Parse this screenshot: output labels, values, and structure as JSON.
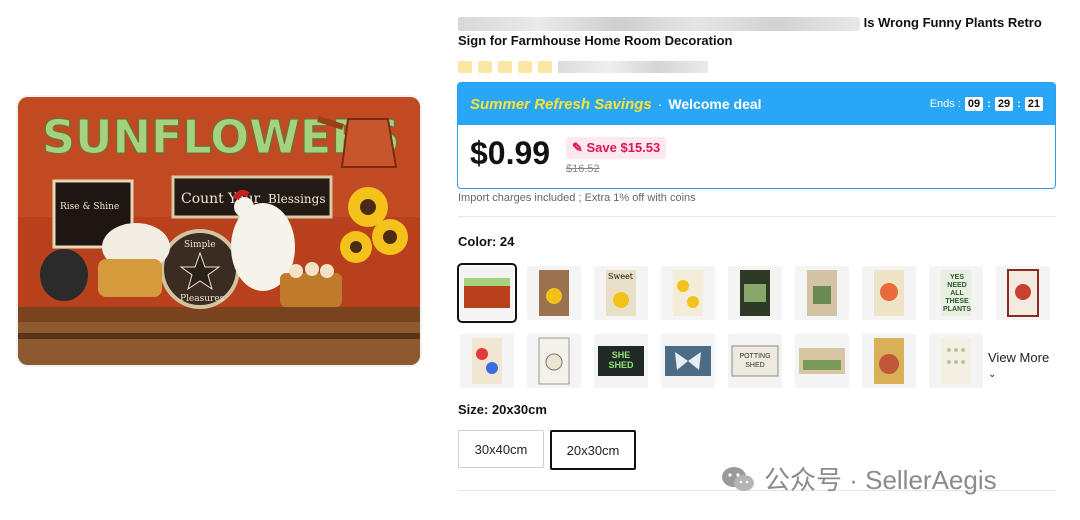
{
  "product": {
    "title_tail": "Is Wrong Funny Plants Retro",
    "title_line2": "Sign for Farmhouse Home Room Decoration",
    "image_texts": {
      "headline": "SUNFLOWERS",
      "sign_left_a": "Rise & Shine",
      "sign_middle_a": "Count",
      "sign_middle_b": "Your",
      "sign_middle_c": "Blessings",
      "plaque_top": "Simple",
      "plaque_bottom": "Pleasures"
    }
  },
  "deal": {
    "name": "Summer Refresh Savings",
    "separator": "·",
    "tag": "Welcome deal",
    "ends_label": "Ends :",
    "timer": [
      "09",
      "29",
      "21"
    ],
    "price": "$0.99",
    "save": "Save $15.53",
    "old_price": "$16.52"
  },
  "import_note": "Import charges included ; Extra 1% off with coins",
  "color": {
    "label": "Color: 24",
    "view_more": "View More",
    "thumb_labels": {
      "t2": "Sweet",
      "t7": "YES NEED ALL THESE PLANTS",
      "t12": "SHE SHED",
      "t14": "POTTING SHED"
    }
  },
  "size": {
    "label": "Size: 20x30cm",
    "options": [
      "30x40cm",
      "20x30cm"
    ]
  },
  "watermark": {
    "text": "公众号 · SellerAegis"
  }
}
